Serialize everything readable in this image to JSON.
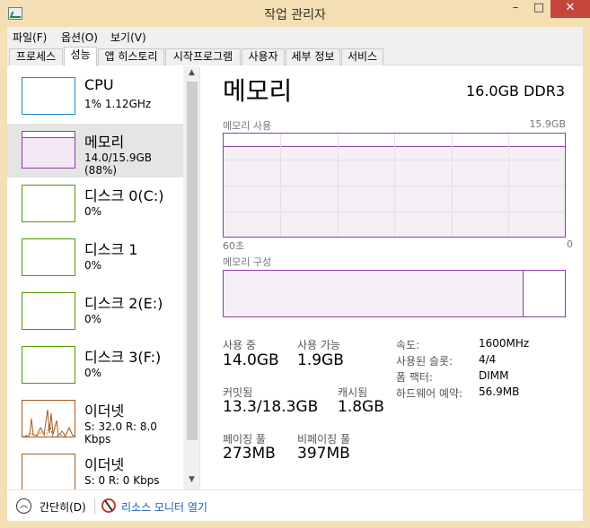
{
  "window": {
    "title": "작업 관리자",
    "controls": {
      "minimize": "–",
      "maximize": "□",
      "close": "✕"
    }
  },
  "menu": {
    "items": [
      {
        "label": "파일(F)"
      },
      {
        "label": "옵션(O)"
      },
      {
        "label": "보기(V)"
      }
    ]
  },
  "tabs": [
    {
      "label": "프로세스"
    },
    {
      "label": "성능"
    },
    {
      "label": "앱 히스토리"
    },
    {
      "label": "시작프로그램"
    },
    {
      "label": "사용자"
    },
    {
      "label": "세부 정보"
    },
    {
      "label": "서비스"
    }
  ],
  "sidebar": {
    "items": [
      {
        "name": "CPU",
        "sub": "1% 1.12GHz",
        "color": "#1b8ac9"
      },
      {
        "name": "메모리",
        "sub": "14.0/15.9GB (88%)",
        "color": "#8e3ea6"
      },
      {
        "name": "디스크 0(C:)",
        "sub": "0%",
        "color": "#4e9a06"
      },
      {
        "name": "디스크 1",
        "sub": "0%",
        "color": "#4e9a06"
      },
      {
        "name": "디스크 2(E:)",
        "sub": "0%",
        "color": "#4e9a06"
      },
      {
        "name": "디스크 3(F:)",
        "sub": "0%",
        "color": "#4e9a06"
      },
      {
        "name": "이더넷",
        "sub": "S: 32.0  R: 8.0 Kbps",
        "color": "#a35a1e"
      },
      {
        "name": "이더넷",
        "sub": "S: 0  R: 0 Kbps",
        "color": "#a35a1e"
      }
    ],
    "scroll_up": "▲",
    "scroll_down": "▼"
  },
  "memory": {
    "title": "메모리",
    "spec": "16.0GB DDR3",
    "usage_label": "메모리 사용",
    "usage_max": "15.9GB",
    "time_left": "60초",
    "time_right": "0",
    "usage_fraction": 0.88,
    "composition_label": "메모리 구성",
    "composition_in_use_fraction": 0.88,
    "stats": {
      "in_use_label": "사용 중",
      "in_use": "14.0GB",
      "available_label": "사용 가능",
      "available": "1.9GB",
      "committed_label": "커밋됨",
      "committed": "13.3/18.3GB",
      "cached_label": "캐시됨",
      "cached": "1.8GB",
      "paged_label": "페이징 풀",
      "paged": "273MB",
      "nonpaged_label": "비페이징 풀",
      "nonpaged": "397MB"
    },
    "specs": {
      "speed_label": "속도:",
      "speed": "1600MHz",
      "slots_label": "사용된 슬롯:",
      "slots": "4/4",
      "form_label": "폼 팩터:",
      "form": "DIMM",
      "reserved_label": "하드웨어 예약:",
      "reserved": "56.9MB"
    },
    "color": "#8e3ea6"
  },
  "footer": {
    "fewer_details": "간단히(D)",
    "fewer_icon": "chevron-up-icon",
    "resource_monitor": "리소스 모니터 열기",
    "monitor_icon": "resource-monitor-icon"
  }
}
